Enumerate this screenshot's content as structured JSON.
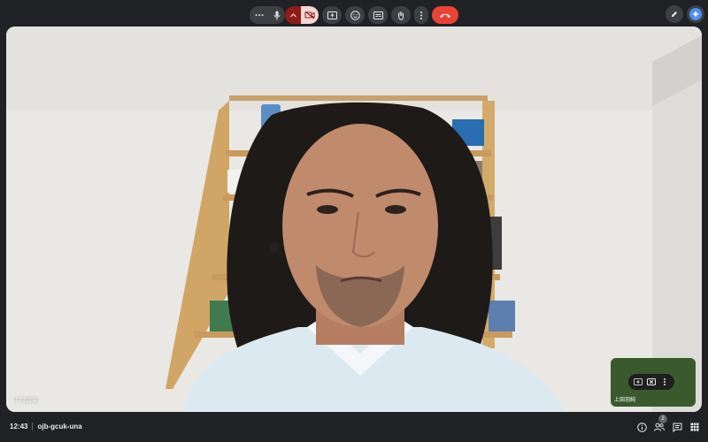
{
  "meeting": {
    "time": "12:43",
    "code": "ojb-gcuk-una"
  },
  "participants": {
    "main_name": "中村富男",
    "self_name": "上田羽純",
    "count": "2"
  },
  "icons": {
    "top": [
      "edit-pen-icon",
      "gemini-sparkle-icon"
    ],
    "controls": [
      "more-options-icon",
      "microphone-icon",
      "chevron-up-icon",
      "camera-off-icon",
      "present-screen-icon",
      "emoji-reaction-icon",
      "captions-icon",
      "raise-hand-icon",
      "more-vert-icon",
      "end-call-icon"
    ],
    "right": [
      "info-icon",
      "people-icon",
      "chat-icon",
      "activities-grid-icon"
    ]
  },
  "colors": {
    "background": "#202124",
    "control": "#3c4043",
    "camera_off_bg": "#f6d7d4",
    "camera_chevron_bg": "#8c1d18",
    "end_call": "#ea4335",
    "gemini": "#4f8cf7"
  }
}
